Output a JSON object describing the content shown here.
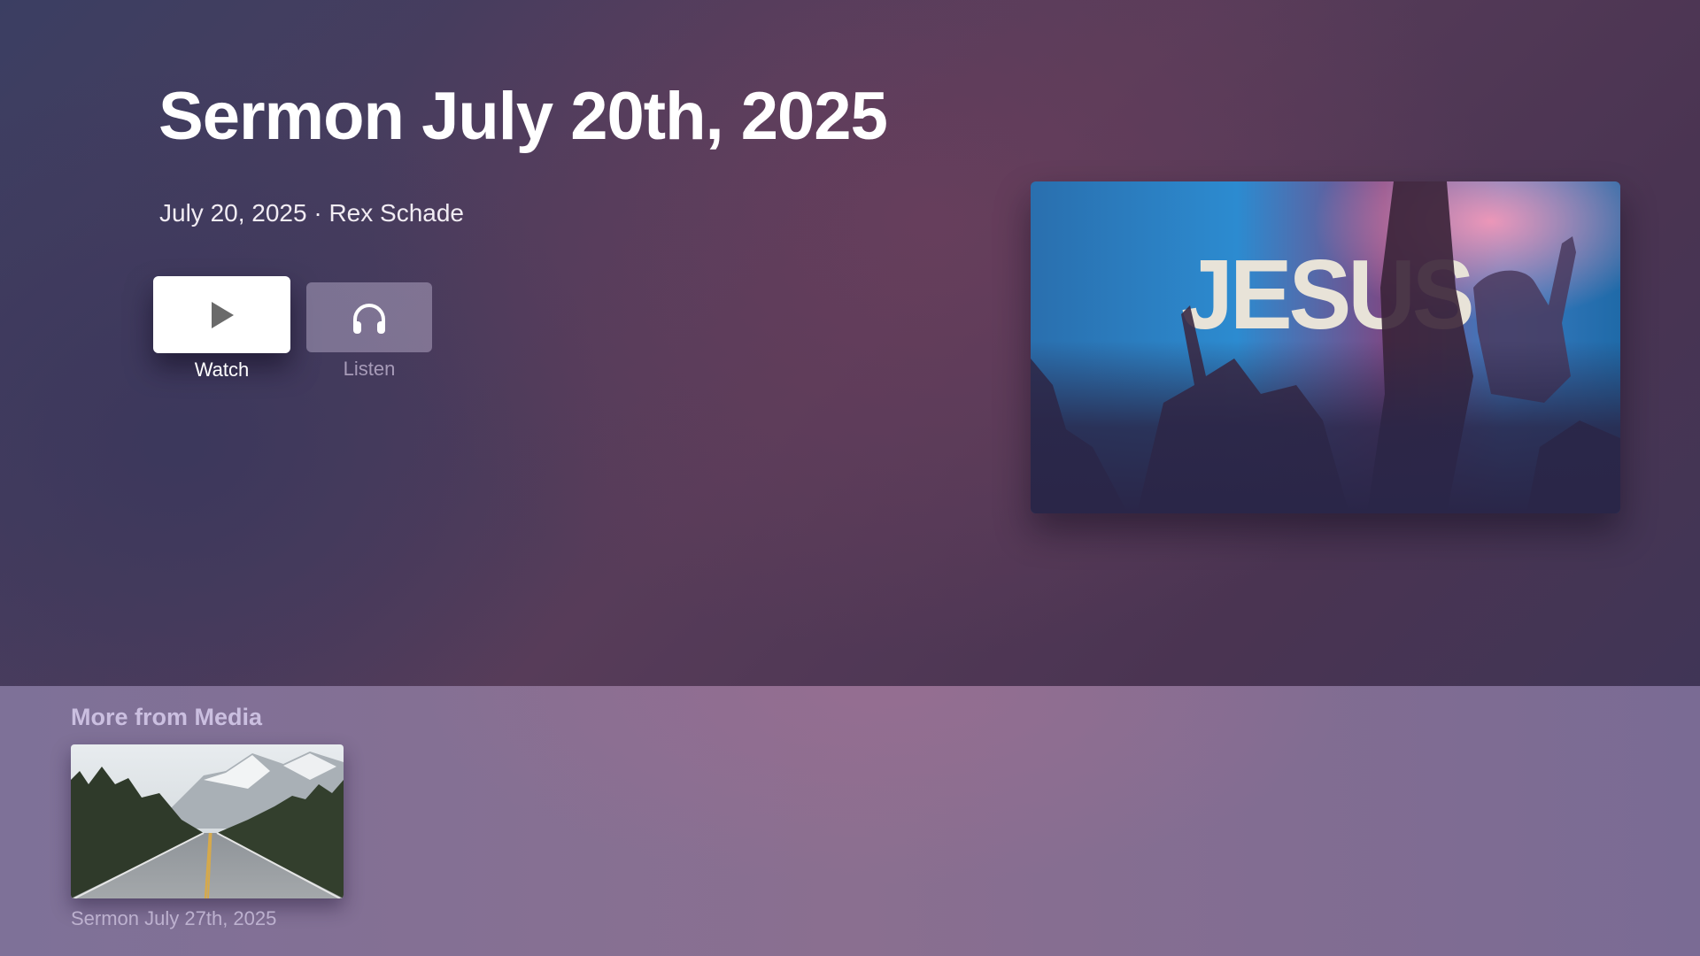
{
  "hero": {
    "title": "Sermon July 20th, 2025",
    "meta": "July 20, 2025 · Rex Schade",
    "artwork_text": "JESUS",
    "actions": [
      {
        "label": "Watch",
        "icon": "play-icon",
        "focused": true
      },
      {
        "label": "Listen",
        "icon": "headphones-icon",
        "focused": false
      }
    ]
  },
  "shelf": {
    "title": "More from Media",
    "items": [
      {
        "label": "Sermon July 27th, 2025",
        "artwork": "mountain-road"
      }
    ]
  },
  "colors": {
    "background_top": "#573c59",
    "shelf_background": "#857197",
    "focused_button": "#ffffff",
    "unfocused_button": "#8b7f9e"
  }
}
